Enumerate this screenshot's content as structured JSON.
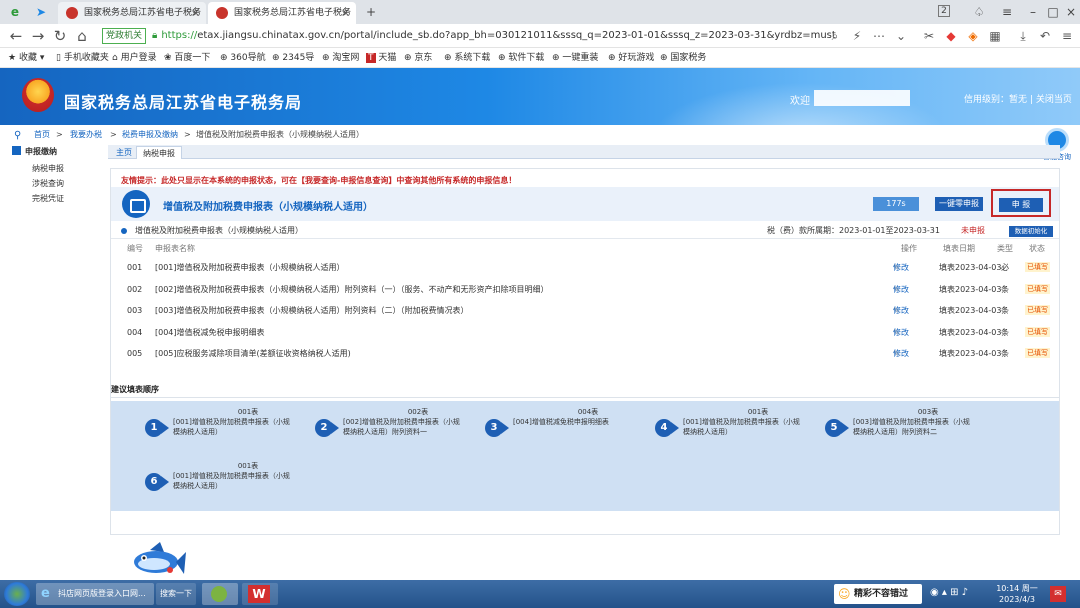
{
  "browser": {
    "tabs": [
      {
        "label": "国家税务总局江苏省电子税务",
        "active": false
      },
      {
        "label": "国家税务总局江苏省电子税务",
        "active": true
      }
    ],
    "new_tab": "+",
    "window_num": "2",
    "address": {
      "badge": "党政机关",
      "scheme": "https://",
      "url": "etax.jiangsu.chinatax.gov.cn/portal/include_sb.do?app_bh=030121011&sssq_q=2023-01-01&sssq_z=2023-03-31&yrdbz=must"
    },
    "bookmarks": [
      "收藏",
      "手机收藏夹",
      "用户登录",
      "百度一下",
      "360导航",
      "2345导",
      "淘宝网",
      "天猫",
      "京东",
      "系统下载",
      "软件下载",
      "一键重装",
      "好玩游戏",
      "国家税务"
    ]
  },
  "site": {
    "title": "国家税务总局江苏省电子税务局",
    "welcome": "欢迎",
    "credit": "信用级别：暂无",
    "separator": "|",
    "close_page": "关闭当页",
    "help": "智能咨询"
  },
  "breadcrumb": [
    "首页",
    ">",
    "我要办税",
    ">",
    "税费申报及缴纳",
    ">",
    "增值税及附加税费申报表（小规模纳税人适用）"
  ],
  "leftnav": {
    "header": "申报缴纳",
    "items": [
      "纳税申报",
      "涉税查询",
      "完税凭证"
    ]
  },
  "pagetabs": [
    "主页",
    "纳税申报"
  ],
  "main": {
    "notice": "友情提示：此处只显示在本系统的申报状态，可在【我要查询-申报信息查询】中查询其他所有系统的申报信息！",
    "form_title": "增值税及附加税费申报表（小规模纳税人适用）",
    "timer": "177s",
    "zero_button": "一键零申报",
    "declare_button": "申 报",
    "tax_name": "增值税及附加税费申报表（小规模纳税人适用）",
    "period": "税（费）款所属期：2023-01-01至2023-03-31",
    "status": "未申报",
    "init_button": "数据初始化",
    "columns": [
      "编号",
      "申报表名称",
      "操作",
      "填表日期",
      "类型",
      "状态"
    ],
    "rows": [
      {
        "no": "001",
        "name": "[001]增值税及附加税费申报表（小规模纳税人适用）",
        "op": "修改",
        "date": "填表2023-04-03",
        "type": "必",
        "state": "已填写"
      },
      {
        "no": "002",
        "name": "[002]增值税及附加税费申报表（小规模纳税人适用）附列资料（一）（服务、不动产和无形资产扣除项目明细）",
        "op": "修改",
        "date": "填表2023-04-03",
        "type": "条",
        "state": "已填写"
      },
      {
        "no": "003",
        "name": "[003]增值税及附加税费申报表（小规模纳税人适用）附列资料（二）（附加税费情况表）",
        "op": "修改",
        "date": "填表2023-04-03",
        "type": "条",
        "state": "已填写"
      },
      {
        "no": "004",
        "name": "[004]增值税减免税申报明细表",
        "op": "修改",
        "date": "填表2023-04-03",
        "type": "条",
        "state": "已填写"
      },
      {
        "no": "005",
        "name": "[005]应税服务减除项目清单(差额征收资格纳税人适用)",
        "op": "修改",
        "date": "填表2023-04-03",
        "type": "条",
        "state": "已填写"
      }
    ],
    "order_title": "建议填表顺序",
    "steps": [
      {
        "num": "1",
        "code": "001表",
        "desc": "[001]增值税及附加税费申报表（小规模纳税人适用）"
      },
      {
        "num": "2",
        "code": "002表",
        "desc": "[002]增值税及附加税费申报表（小规模纳税人适用）附列资料一"
      },
      {
        "num": "3",
        "code": "004表",
        "desc": "[004]增值税减免税申报明细表"
      },
      {
        "num": "4",
        "code": "001表",
        "desc": "[001]增值税及附加税费申报表（小规模纳税人适用）"
      },
      {
        "num": "5",
        "code": "003表",
        "desc": "[003]增值税及附加税费申报表（小规模纳税人适用）附列资料二"
      },
      {
        "num": "6",
        "code": "001表",
        "desc": "[001]增值税及附加税费申报表（小规模纳税人适用）"
      }
    ]
  },
  "taskbar": {
    "task1": "抖店网页版登录入口网...",
    "task2": "搜索一下",
    "notify": "精彩不容错过",
    "time": "10:14 周一",
    "date": "2023/4/3"
  },
  "colors": {
    "accent": "#1e5fb4",
    "warning": "#c62828",
    "header": "#1e88e5"
  }
}
